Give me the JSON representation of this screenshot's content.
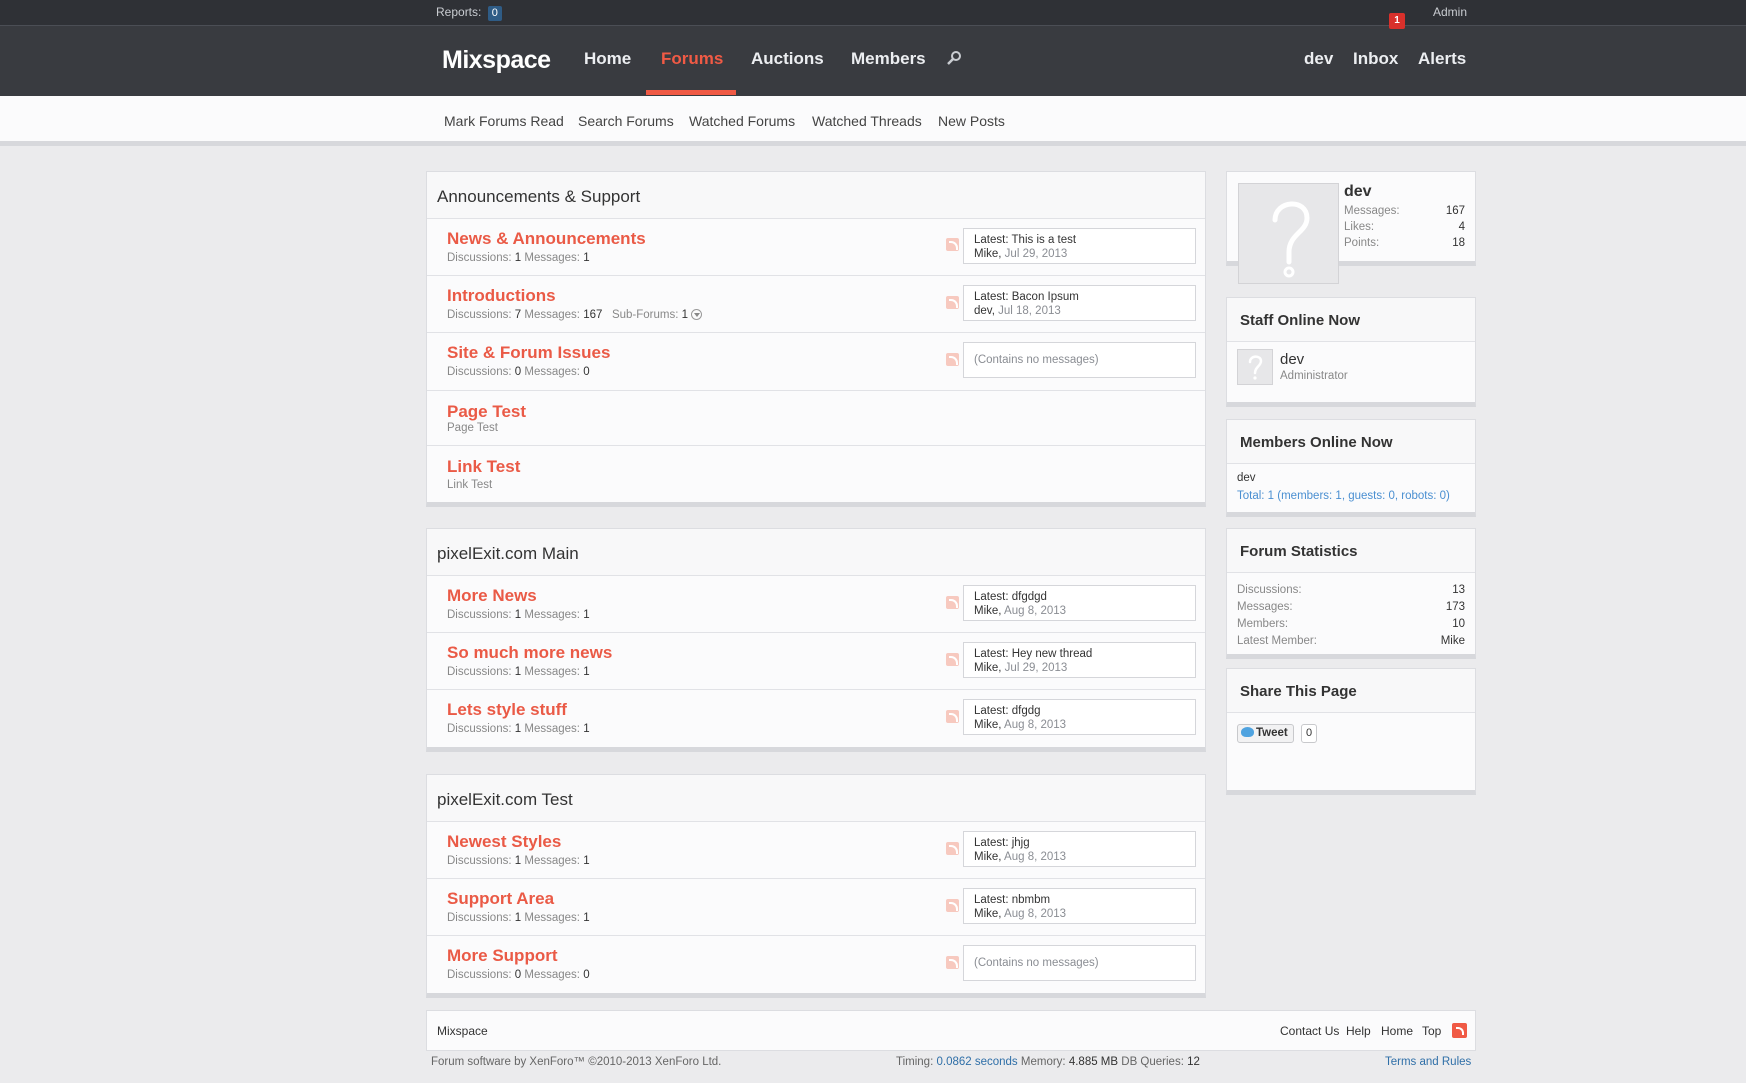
{
  "topbar": {
    "reports_label": "Reports:",
    "reports_count": "0",
    "admin_label": "Admin",
    "inbox_badge": "1"
  },
  "header": {
    "logo": "Mixspace",
    "nav": [
      "Home",
      "Forums",
      "Auctions",
      "Members"
    ],
    "active_tab": "Forums",
    "user_links": [
      "dev",
      "Inbox",
      "Alerts"
    ]
  },
  "subnav": [
    "Mark Forums Read",
    "Search Forums",
    "Watched Forums",
    "Watched Threads",
    "New Posts"
  ],
  "categories": [
    {
      "title": "Announcements & Support",
      "forums": [
        {
          "title": "News & Announcements",
          "discussions": "1",
          "messages": "1",
          "latest_title": "This is a test",
          "latest_user": "Mike",
          "latest_date": "Jul 29, 2013"
        },
        {
          "title": "Introductions",
          "discussions": "7",
          "messages": "167",
          "subforums": "1",
          "latest_title": "Bacon Ipsum",
          "latest_user": "dev",
          "latest_date": "Jul 18, 2013"
        },
        {
          "title": "Site & Forum Issues",
          "discussions": "0",
          "messages": "0",
          "empty_text": "(Contains no messages)"
        },
        {
          "title": "Page Test",
          "description": "Page Test"
        },
        {
          "title": "Link Test",
          "description": "Link Test"
        }
      ]
    },
    {
      "title": "pixelExit.com Main",
      "forums": [
        {
          "title": "More News",
          "discussions": "1",
          "messages": "1",
          "latest_title": "dfgdgd",
          "latest_user": "Mike",
          "latest_date": "Aug 8, 2013"
        },
        {
          "title": "So much more news",
          "discussions": "1",
          "messages": "1",
          "latest_title": "Hey new thread",
          "latest_user": "Mike",
          "latest_date": "Jul 29, 2013"
        },
        {
          "title": "Lets style stuff",
          "discussions": "1",
          "messages": "1",
          "latest_title": "dfgdg",
          "latest_user": "Mike",
          "latest_date": "Aug 8, 2013"
        }
      ]
    },
    {
      "title": "pixelExit.com Test",
      "forums": [
        {
          "title": "Newest Styles",
          "discussions": "1",
          "messages": "1",
          "latest_title": "jhjg",
          "latest_user": "Mike",
          "latest_date": "Aug 8, 2013"
        },
        {
          "title": "Support Area",
          "discussions": "1",
          "messages": "1",
          "latest_title": "nbmbm",
          "latest_user": "Mike",
          "latest_date": "Aug 8, 2013"
        },
        {
          "title": "More Support",
          "discussions": "0",
          "messages": "0",
          "empty_text": "(Contains no messages)"
        }
      ]
    }
  ],
  "labels": {
    "discussions": "Discussions:",
    "messages": "Messages:",
    "subforums": "Sub-Forums:",
    "latest": "Latest:"
  },
  "profile": {
    "name": "dev",
    "messages_label": "Messages:",
    "messages": "167",
    "likes_label": "Likes:",
    "likes": "4",
    "points_label": "Points:",
    "points": "18"
  },
  "staff_online": {
    "title": "Staff Online Now",
    "name": "dev",
    "role": "Administrator"
  },
  "members_online": {
    "title": "Members Online Now",
    "name": "dev",
    "total": "Total: 1 (members: 1, guests: 0, robots: 0)"
  },
  "forum_stats": {
    "title": "Forum Statistics",
    "rows": [
      {
        "label": "Discussions:",
        "value": "13"
      },
      {
        "label": "Messages:",
        "value": "173"
      },
      {
        "label": "Members:",
        "value": "10"
      },
      {
        "label": "Latest Member:",
        "value": "Mike"
      }
    ]
  },
  "share": {
    "title": "Share This Page",
    "tweet_label": "Tweet",
    "tweet_count": "0"
  },
  "footer": {
    "brand": "Mixspace",
    "links": [
      "Contact Us",
      "Help",
      "Home",
      "Top"
    ],
    "copyright": "Forum software by XenForo™ ©2010-2013 XenForo Ltd.",
    "timing_label": "Timing:",
    "timing_value": "0.0862 seconds",
    "memory_label": "Memory:",
    "memory_value": "4.885 MB",
    "db_label": "DB Queries:",
    "db_value": "12",
    "terms": "Terms and Rules"
  },
  "colors": {
    "accent": "#f05a45",
    "header_bg": "#393b40",
    "link_blue": "#2f6fa8"
  }
}
